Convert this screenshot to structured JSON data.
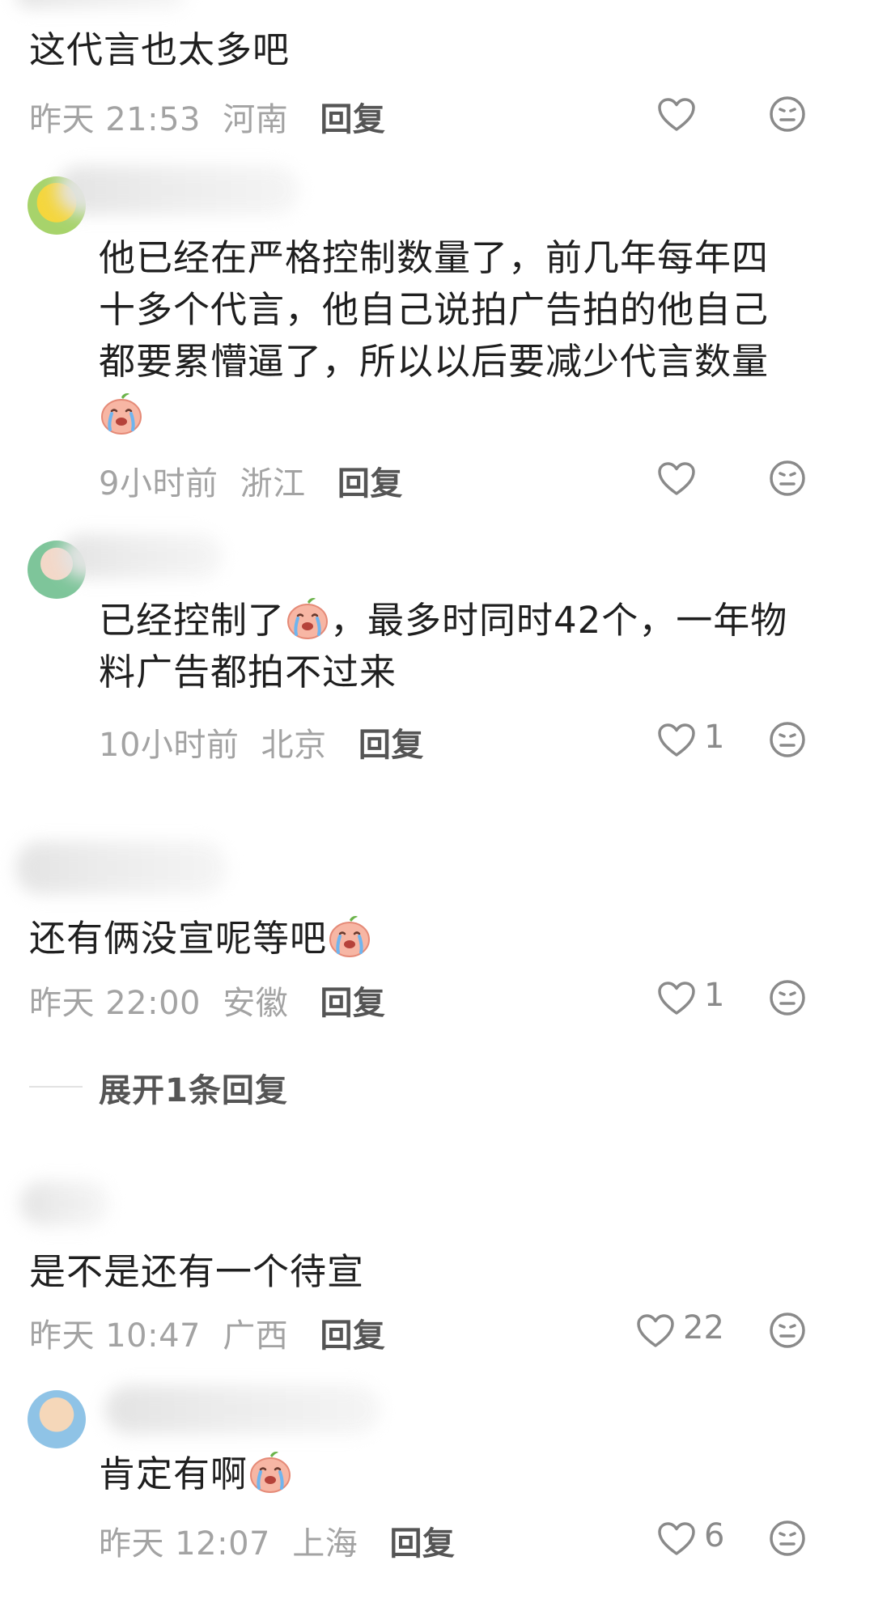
{
  "comments": [
    {
      "text": "这代言也太多吧",
      "time": "昨天 21:53",
      "location": "河南",
      "reply": "回复",
      "likes": ""
    },
    {
      "text": "他已经在严格控制数量了，前几年每年四十多个代言，他自己说拍广告拍的他自己都要累懵逼了，所以以后要减少代言数量",
      "time": "9小时前",
      "location": "浙江",
      "reply": "回复",
      "likes": ""
    },
    {
      "text_a": "已经控制了",
      "text_b": "，最多时同时42个，一年物料广告都拍不过来",
      "time": "10小时前",
      "location": "北京",
      "reply": "回复",
      "likes": "1"
    },
    {
      "text": "还有俩没宣呢等吧",
      "time": "昨天 22:00",
      "location": "安徽",
      "reply": "回复",
      "likes": "1",
      "expand": "展开1条回复"
    },
    {
      "text": "是不是还有一个待宣",
      "time": "昨天 10:47",
      "location": "广西",
      "reply": "回复",
      "likes": "22"
    },
    {
      "text": "肯定有啊",
      "time": "昨天 12:07",
      "location": "上海",
      "reply": "回复",
      "likes": "6"
    }
  ],
  "icons": {
    "like": "heart-outline-icon",
    "react": "neutral-face-icon",
    "emoji": "crying-peach-emoji"
  },
  "colors": {
    "meta": "#a3a3a3",
    "reply": "#555555",
    "icon": "#8a8a8a"
  }
}
